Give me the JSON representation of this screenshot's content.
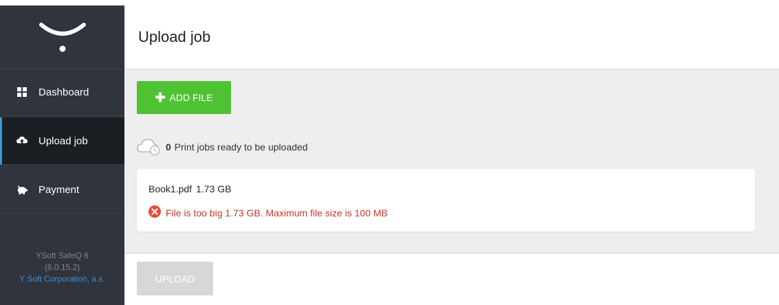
{
  "sidebar": {
    "items": [
      {
        "label": "Dashboard",
        "icon": "dashboard-grid-icon"
      },
      {
        "label": "Upload job",
        "icon": "cloud-upload-icon",
        "active": true
      },
      {
        "label": "Payment",
        "icon": "piggy-bank-icon"
      }
    ],
    "footer": {
      "product": "YSoft SafeQ 6",
      "version": "(6.0.15.2)",
      "company": "Y Soft Corporation, a.s."
    }
  },
  "header": {
    "title": "Upload job"
  },
  "actions": {
    "add_file_label": "ADD FILE",
    "upload_label": "UPLOAD"
  },
  "status": {
    "count": "0",
    "text": "Print jobs ready to be uploaded"
  },
  "file": {
    "name": "Book1.pdf",
    "size": "1.73 GB",
    "error": "File is too big 1.73 GB. Maximum file size is 100 MB"
  },
  "colors": {
    "accent_green": "#4fc234",
    "sidebar_bg": "#2f343d",
    "active_border": "#3f97cf",
    "error": "#c0392b",
    "disabled": "#d7d7d7"
  }
}
